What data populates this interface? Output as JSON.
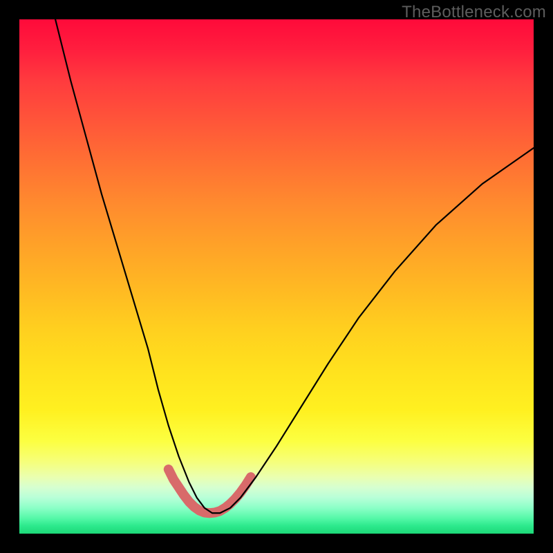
{
  "watermark": "TheBottleneck.com",
  "chart_data": {
    "type": "line",
    "title": "",
    "xlabel": "",
    "ylabel": "",
    "xlim": [
      0,
      100
    ],
    "ylim": [
      0,
      100
    ],
    "series": [
      {
        "name": "bottleneck-curve",
        "x": [
          7,
          10,
          13,
          16,
          19,
          22,
          25,
          27,
          29,
          31,
          33,
          34.5,
          36,
          37.5,
          39,
          41,
          43,
          46,
          50,
          55,
          60,
          66,
          73,
          81,
          90,
          100
        ],
        "values": [
          100,
          88,
          77,
          66,
          56,
          46,
          36,
          28,
          21,
          15,
          10,
          7,
          5,
          4,
          4,
          5,
          7,
          11,
          17,
          25,
          33,
          42,
          51,
          60,
          68,
          75
        ]
      }
    ],
    "markers": {
      "name": "highlight-segment",
      "color": "#d86a6a",
      "stroke_width": 14,
      "x": [
        29,
        30,
        31,
        32,
        33,
        34,
        35,
        36,
        37,
        38,
        39,
        40,
        41,
        42,
        43,
        44,
        45
      ],
      "values": [
        12.5,
        10.5,
        9,
        7.5,
        6.2,
        5.2,
        4.5,
        4.1,
        4,
        4.1,
        4.4,
        5,
        5.8,
        6.8,
        8,
        9.4,
        11
      ]
    },
    "background_gradient": {
      "stops": [
        {
          "pos": 0,
          "color": "#ff0a3a"
        },
        {
          "pos": 50,
          "color": "#ffb823"
        },
        {
          "pos": 82,
          "color": "#fcff41"
        },
        {
          "pos": 100,
          "color": "#1dd878"
        }
      ],
      "direction": "top-to-bottom"
    }
  }
}
